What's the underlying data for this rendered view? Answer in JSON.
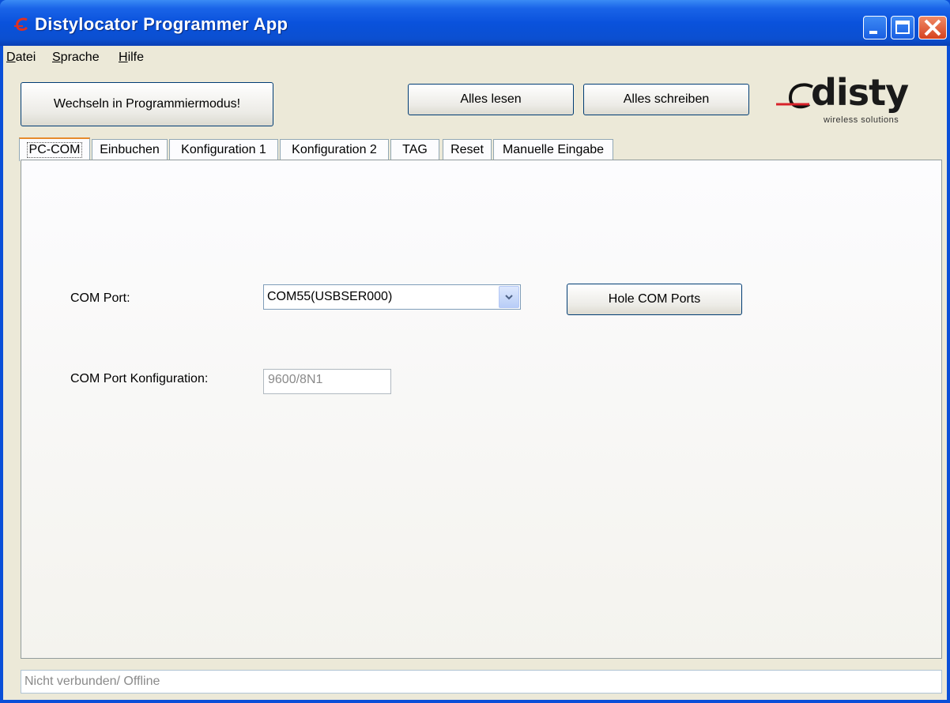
{
  "window": {
    "title": "Distylocator Programmer App"
  },
  "menu": {
    "items": [
      {
        "label": "Datei",
        "mnemonic": "D",
        "rest": "atei"
      },
      {
        "label": "Sprache",
        "mnemonic": "S",
        "rest": "prache"
      },
      {
        "label": "Hilfe",
        "mnemonic": "H",
        "rest": "ilfe"
      }
    ]
  },
  "toolbar": {
    "program_mode_label": "Wechseln in Programmiermodus!",
    "read_all_label": "Alles lesen",
    "write_all_label": "Alles schreiben"
  },
  "logo": {
    "brand": "disty",
    "tagline": "wireless solutions"
  },
  "tabs": [
    {
      "label": "PC-COM",
      "active": true
    },
    {
      "label": "Einbuchen"
    },
    {
      "label": "Konfiguration 1"
    },
    {
      "label": "Konfiguration 2"
    },
    {
      "label": "TAG"
    },
    {
      "label": "Reset"
    },
    {
      "label": "Manuelle Eingabe"
    }
  ],
  "pccom": {
    "com_port_label": "COM Port:",
    "com_port_value": "COM55(USBSER000)",
    "fetch_ports_label": "Hole COM Ports",
    "com_config_label": "COM Port Konfiguration:",
    "com_config_value": "9600/8N1"
  },
  "status": {
    "text": "Nicht verbunden/ Offline"
  },
  "colors": {
    "titlebar": "#0a52dc",
    "tab_active_accent": "#e68b2c",
    "background": "#ece9d8"
  }
}
